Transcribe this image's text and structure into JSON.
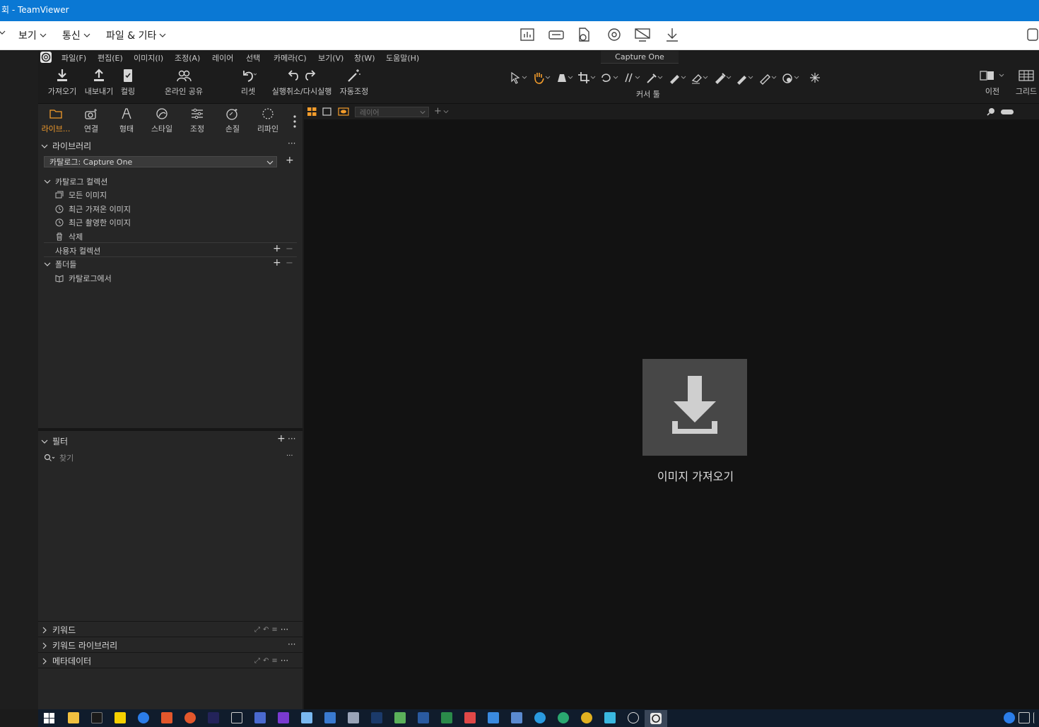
{
  "teamviewer": {
    "title": "회 - TeamViewer",
    "menu": [
      {
        "label": "보기"
      },
      {
        "label": "통신"
      },
      {
        "label": "파일 & 기타"
      }
    ],
    "toolbar_icons": [
      "chart-icon",
      "keyboard-icon",
      "file-transfer-icon",
      "reboot-icon",
      "disable-screen-icon",
      "download-icon"
    ],
    "right_icon": "chat-icon"
  },
  "capture_one": {
    "window_title": "Capture One",
    "menubar": [
      {
        "label": "파일(F)"
      },
      {
        "label": "편집(E)"
      },
      {
        "label": "이미지(I)"
      },
      {
        "label": "조정(A)"
      },
      {
        "label": "레이어"
      },
      {
        "label": "선택"
      },
      {
        "label": "카메라(C)"
      },
      {
        "label": "보기(V)"
      },
      {
        "label": "창(W)"
      },
      {
        "label": "도움말(H)"
      }
    ],
    "toolbar": {
      "import": "가져오기",
      "export": "내보내기",
      "culling": "컬링",
      "online_share": "온라인 공유",
      "reset": "리셋",
      "undo_redo": "실행취소/다시실행",
      "auto_adjust": "자동조정",
      "cursor_tools": "커서 툴",
      "before": "이전",
      "grid": "그리드"
    },
    "tool_tabs": [
      {
        "label": "라이브...",
        "icon": "folder-icon"
      },
      {
        "label": "연결",
        "icon": "camera-icon"
      },
      {
        "label": "형태",
        "icon": "lens-icon"
      },
      {
        "label": "스타일",
        "icon": "style-icon"
      },
      {
        "label": "조정",
        "icon": "sliders-icon"
      },
      {
        "label": "손질",
        "icon": "retouch-icon"
      },
      {
        "label": "리파인",
        "icon": "refine-icon"
      }
    ],
    "library": {
      "header": "라이브러리",
      "catalog_select": "카탈로그: Capture One",
      "catalog_collections": "카탈로그 컬렉션",
      "items": [
        {
          "label": "모든 이미지",
          "icon": "images-icon"
        },
        {
          "label": "최근 가져온 이미지",
          "icon": "clock-icon"
        },
        {
          "label": "최근 촬영한 이미지",
          "icon": "clock-icon"
        },
        {
          "label": "삭제",
          "icon": "trash-icon"
        }
      ],
      "user_collections": "사용자 컬렉션",
      "folders": "폴더들",
      "folder_items": [
        {
          "label": "카탈로그에서",
          "icon": "catalog-book-icon"
        }
      ]
    },
    "filter": {
      "header": "필터",
      "search_placeholder": "찾기"
    },
    "collapsed_tools": [
      {
        "label": "키워드"
      },
      {
        "label": "키워드 라이브러리"
      },
      {
        "label": "메타데이터"
      }
    ],
    "viewer": {
      "layer_select": "레이어",
      "import_label": "이미지 가져오기"
    }
  },
  "colors": {
    "teamviewer_blue": "#0a78d4",
    "accent_orange": "#f39c2b",
    "panel_bg": "#262626",
    "viewer_bg": "#121212"
  }
}
